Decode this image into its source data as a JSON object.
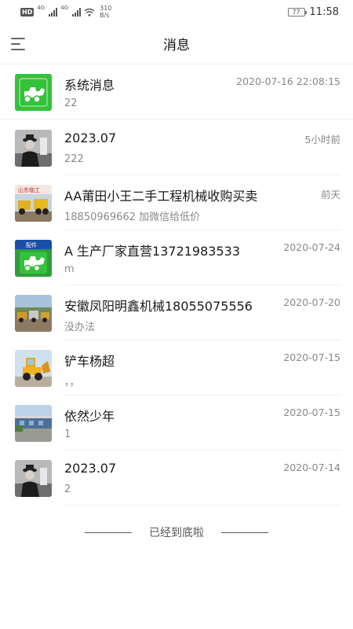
{
  "status_bar": {
    "hd": "HD",
    "signal_labels": [
      "4G",
      "4G"
    ],
    "net_speed_value": "310",
    "net_speed_unit": "B/s",
    "battery": "77",
    "time": "11:58"
  },
  "header": {
    "title": "消息",
    "menu_icon": "menu-icon"
  },
  "system_message": {
    "name": "系统消息",
    "preview": "22",
    "time": "2020-07-16 22:08:15",
    "avatar_color": "#35c13a"
  },
  "messages": [
    {
      "name": "2023.07",
      "preview": "222",
      "time": "5小时前",
      "avatar": "person"
    },
    {
      "name": "AA莆田小王二手工程机械收购买卖",
      "preview": "18850969662 加微信给低价",
      "time": "前天",
      "avatar": "loaders",
      "avatar_text": "山东临工"
    },
    {
      "name": "A 生产厂家直营13721983533",
      "preview": "m",
      "time": "2020-07-24",
      "avatar": "green-loader",
      "avatar_text": "配件"
    },
    {
      "name": "安徽凤阳明鑫机械18055075556",
      "preview": "没办法",
      "time": "2020-07-20",
      "avatar": "yard"
    },
    {
      "name": "铲车杨超",
      "preview": "，，",
      "time": "2020-07-15",
      "avatar": "yellow-loader"
    },
    {
      "name": "依然少年",
      "preview": "1",
      "time": "2020-07-15",
      "avatar": "building"
    },
    {
      "name": "2023.07",
      "preview": "2",
      "time": "2020-07-14",
      "avatar": "person"
    }
  ],
  "footer": {
    "end_text": "已经到底啦"
  },
  "colors": {
    "accent_green": "#35c13a",
    "text_primary": "#1a1a1a",
    "text_secondary": "#888888",
    "divider": "#ececec"
  }
}
